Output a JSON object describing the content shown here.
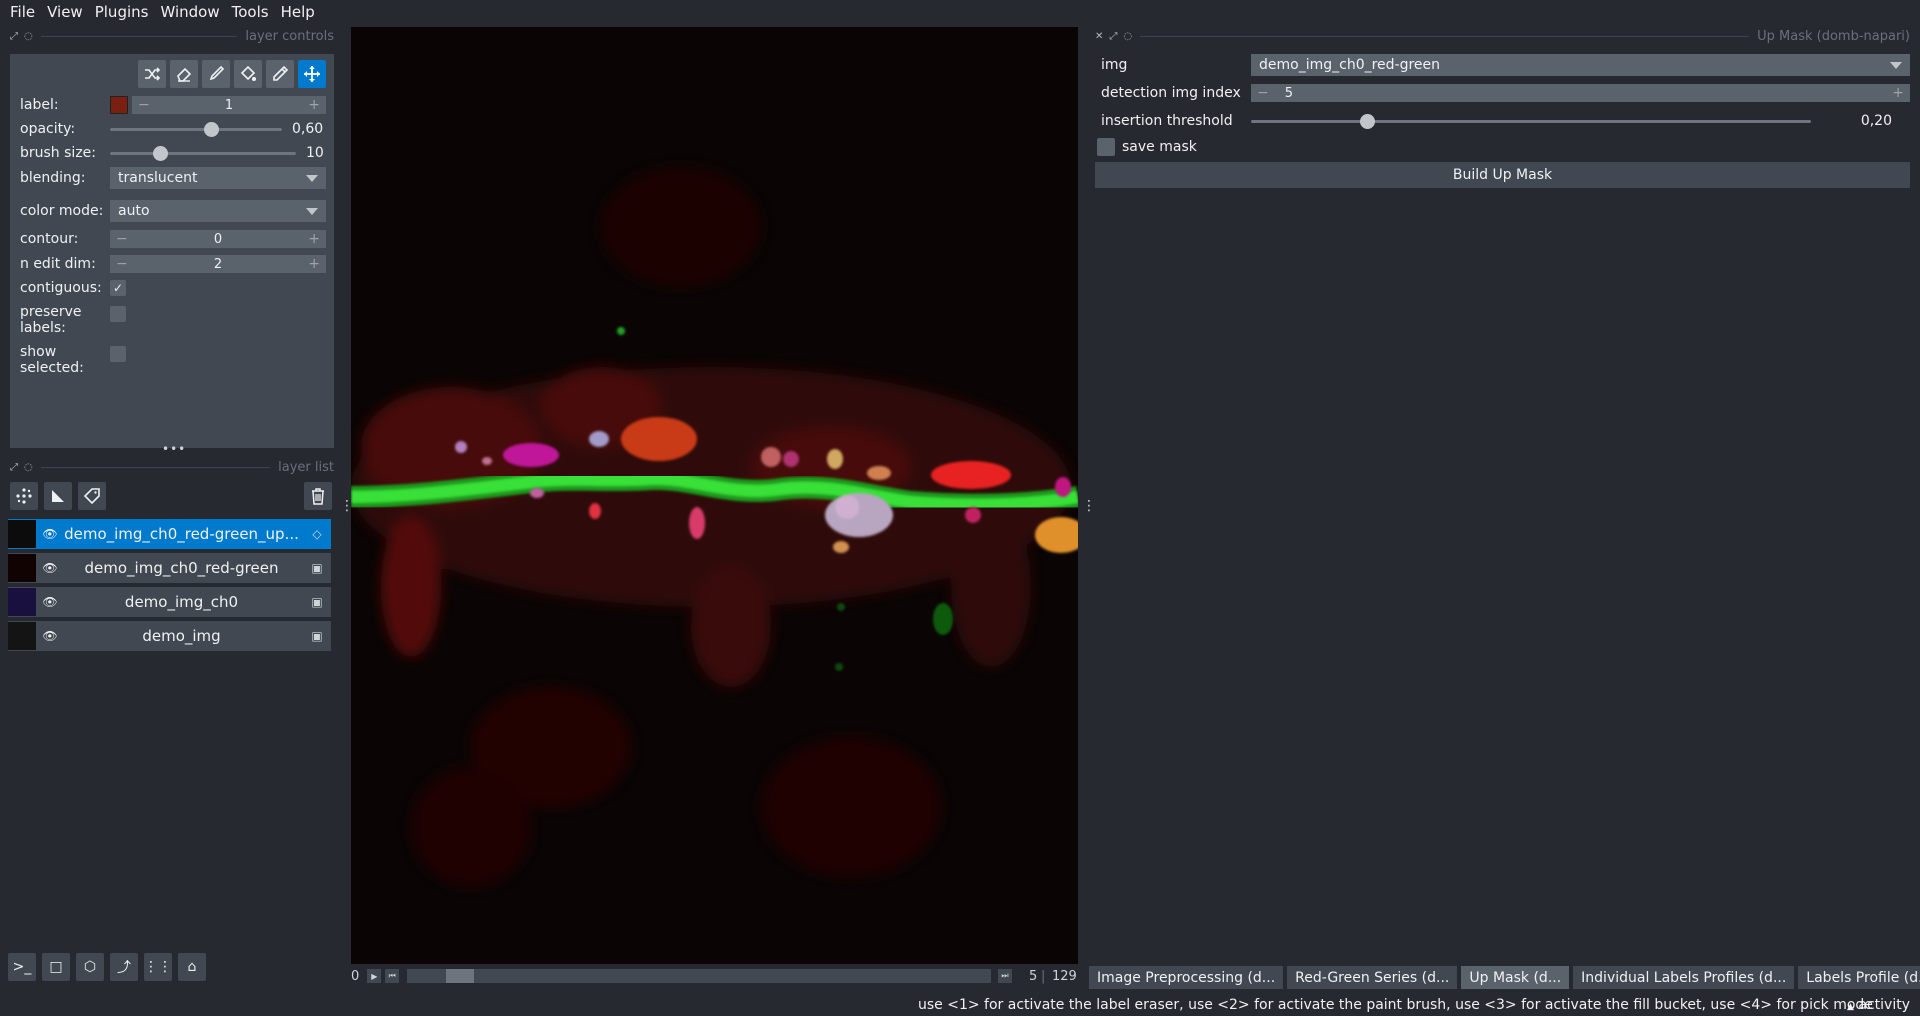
{
  "menubar": [
    "File",
    "View",
    "Plugins",
    "Window",
    "Tools",
    "Help"
  ],
  "layer_controls": {
    "title": "layer controls",
    "label_text": "label:",
    "label_value": "1",
    "label_color": "#7a2010",
    "opacity_text": "opacity:",
    "opacity_value": "0,60",
    "opacity_level": 0.6,
    "brush_text": "brush size:",
    "brush_value": "10",
    "brush_level": 0.25,
    "blending_text": "blending:",
    "blending_value": "translucent",
    "colormode_text": "color mode:",
    "colormode_value": "auto",
    "contour_text": "contour:",
    "contour_value": "0",
    "nedit_text": "n edit dim:",
    "nedit_value": "2",
    "contiguous_text": "contiguous:",
    "preserve_text1": "preserve",
    "preserve_text2": "labels:",
    "show_text1": "show",
    "show_text2": "selected:"
  },
  "layer_list": {
    "title": "layer list",
    "layers": [
      {
        "name": "demo_img_ch0_red-green_up...",
        "type_icon": "label-icon",
        "selected": true
      },
      {
        "name": "demo_img_ch0_red-green",
        "type_icon": "image-icon",
        "selected": false
      },
      {
        "name": "demo_img_ch0",
        "type_icon": "image-icon",
        "selected": false
      },
      {
        "name": "demo_img",
        "type_icon": "image-icon",
        "selected": false
      }
    ]
  },
  "dims": {
    "current": "0",
    "value": "5",
    "total": "129",
    "position_level": 0.07
  },
  "widget": {
    "title": "Up Mask (domb-napari)",
    "img_label": "img",
    "img_value": "demo_img_ch0_red-green",
    "index_label": "detection img index",
    "index_value": "5",
    "threshold_label": "insertion threshold",
    "threshold_value": "0,20",
    "threshold_level": 0.2,
    "save_label": "save mask",
    "build_label": "Build Up Mask"
  },
  "tabs": [
    "Image Preprocessing (d...",
    "Red-Green Series (d...",
    "Up Mask (d...",
    "Individual Labels Profiles (d...",
    "Labels Profile (d..."
  ],
  "active_tab": 2,
  "status": {
    "message": "use <1> for activate the label eraser, use <2> for activate the paint brush, use <3> for activate the fill bucket, use <4> for pick mode",
    "activity": "activity"
  },
  "colors": {
    "accent": "#007acc",
    "panel": "#414851",
    "background": "#262930"
  }
}
